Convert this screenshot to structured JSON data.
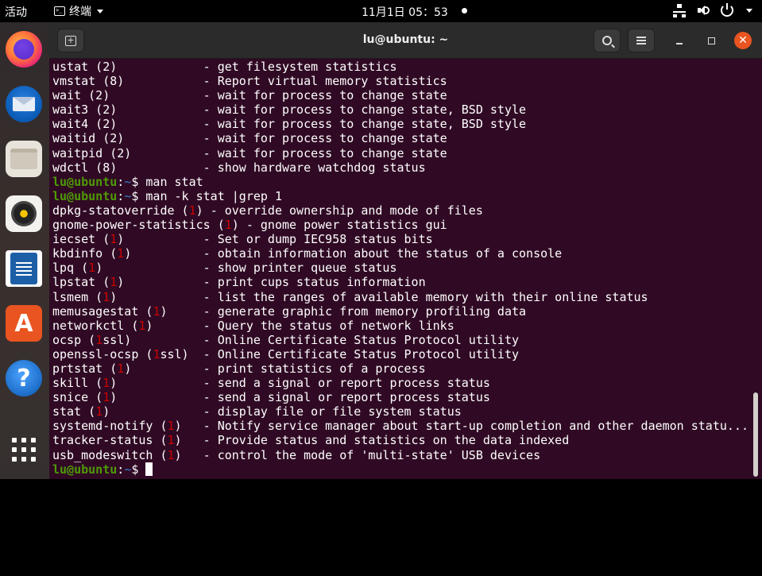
{
  "topbar": {
    "activities": "活动",
    "app_name": "终端",
    "clock": "11月1日  05：53"
  },
  "dock": {
    "items": [
      "firefox",
      "thunderbird",
      "files",
      "rhythmbox",
      "libreoffice-writer",
      "ubuntu-software",
      "help",
      "show-applications"
    ],
    "software_glyph": "A",
    "help_glyph": "?"
  },
  "window": {
    "title": "lu@ubuntu: ~",
    "newtab_glyph": "+",
    "close_glyph": "✕"
  },
  "terminal": {
    "prompt_user": "lu@ubuntu",
    "prompt_path": "~",
    "lines_before": [
      {
        "name": "ustat (2)            ",
        "desc": "- get filesystem statistics"
      },
      {
        "name": "vmstat (8)           ",
        "desc": "- Report virtual memory statistics"
      },
      {
        "name": "wait (2)             ",
        "desc": "- wait for process to change state"
      },
      {
        "name": "wait3 (2)            ",
        "desc": "- wait for process to change state, BSD style"
      },
      {
        "name": "wait4 (2)            ",
        "desc": "- wait for process to change state, BSD style"
      },
      {
        "name": "waitid (2)           ",
        "desc": "- wait for process to change state"
      },
      {
        "name": "waitpid (2)          ",
        "desc": "- wait for process to change state"
      },
      {
        "name": "wdctl (8)            ",
        "desc": "- show hardware watchdog status"
      }
    ],
    "cmd1": "man stat",
    "cmd2": "man -k stat |grep 1",
    "results": [
      {
        "pre": "dpkg-statoverride (",
        "hl": "1",
        "post": ") ",
        "desc": "- override ownership and mode of files"
      },
      {
        "pre": "gnome-power-statistics (",
        "hl": "1",
        "post": ") ",
        "desc": "- gnome power statistics gui"
      },
      {
        "pre": "iecset (",
        "hl": "1",
        "post": ")           ",
        "desc": "- Set or dump IEC958 status bits"
      },
      {
        "pre": "kbdinfo (",
        "hl": "1",
        "post": ")          ",
        "desc": "- obtain information about the status of a console"
      },
      {
        "pre": "lpq (",
        "hl": "1",
        "post": ")              ",
        "desc": "- show printer queue status"
      },
      {
        "pre": "lpstat (",
        "hl": "1",
        "post": ")           ",
        "desc": "- print cups status information"
      },
      {
        "pre": "lsmem (",
        "hl": "1",
        "post": ")            ",
        "desc": "- list the ranges of available memory with their online status"
      },
      {
        "pre": "memusagestat (",
        "hl": "1",
        "post": ")     ",
        "desc": "- generate graphic from memory profiling data"
      },
      {
        "pre": "networkctl (",
        "hl": "1",
        "post": ")       ",
        "desc": "- Query the status of network links"
      },
      {
        "pre": "ocsp (",
        "hl": "1",
        "post": "ssl)          ",
        "desc": "- Online Certificate Status Protocol utility"
      },
      {
        "pre": "openssl-ocsp (",
        "hl": "1",
        "post": "ssl)  ",
        "desc": "- Online Certificate Status Protocol utility"
      },
      {
        "pre": "prtstat (",
        "hl": "1",
        "post": ")          ",
        "desc": "- print statistics of a process"
      },
      {
        "pre": "skill (",
        "hl": "1",
        "post": ")            ",
        "desc": "- send a signal or report process status"
      },
      {
        "pre": "snice (",
        "hl": "1",
        "post": ")            ",
        "desc": "- send a signal or report process status"
      },
      {
        "pre": "stat (",
        "hl": "1",
        "post": ")             ",
        "desc": "- display file or file system status"
      },
      {
        "pre": "systemd-notify (",
        "hl": "1",
        "post": ")   ",
        "desc": "- Notify service manager about start-up completion and other daemon statu..."
      },
      {
        "pre": "tracker-status (",
        "hl": "1",
        "post": ")   ",
        "desc": "- Provide status and statistics on the data indexed"
      },
      {
        "pre": "usb_modeswitch (",
        "hl": "1",
        "post": ")   ",
        "desc": "- control the mode of 'multi-state' USB devices"
      }
    ]
  },
  "colors": {
    "terminal_bg": "#300a24",
    "prompt_user": "#4e9a06",
    "prompt_path": "#3465a4",
    "grep_highlight": "#cc0000",
    "close_button": "#e95420"
  }
}
